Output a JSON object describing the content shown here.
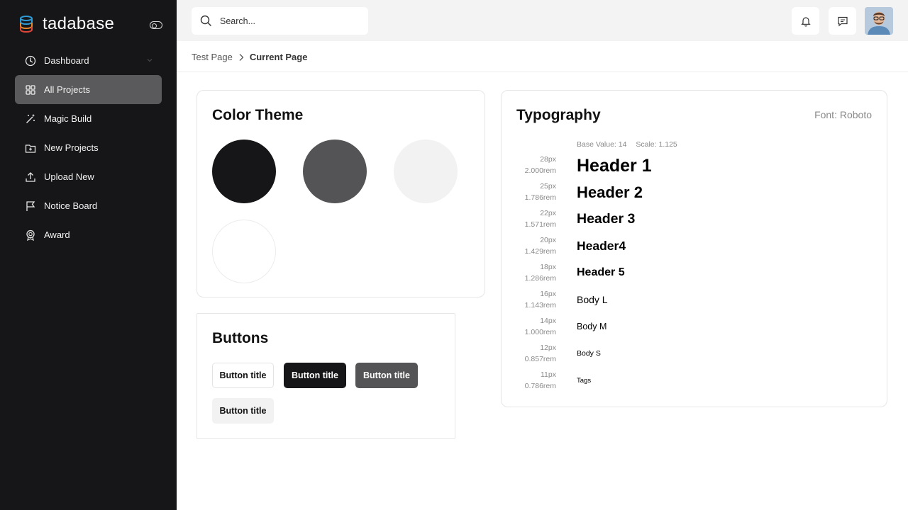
{
  "brand": {
    "name": "tadabase"
  },
  "sidebar": {
    "items": [
      {
        "label": "Dashboard",
        "icon": "dashboard-icon",
        "active": false,
        "has_chevron": true
      },
      {
        "label": "All Projects",
        "icon": "grid-icon",
        "active": true
      },
      {
        "label": "Magic Build",
        "icon": "magic-wand-icon",
        "active": false
      },
      {
        "label": "New Projects",
        "icon": "folder-plus-icon",
        "active": false
      },
      {
        "label": "Upload New",
        "icon": "upload-icon",
        "active": false
      },
      {
        "label": "Notice Board",
        "icon": "flag-icon",
        "active": false
      },
      {
        "label": "Award",
        "icon": "award-icon",
        "active": false
      }
    ]
  },
  "header": {
    "search_placeholder": "Search...",
    "notification_icon": "bell-icon",
    "message_icon": "message-icon"
  },
  "breadcrumb": {
    "parent": "Test Page",
    "current": "Current Page"
  },
  "color_theme": {
    "title": "Color Theme",
    "swatches": [
      "#161618",
      "#545456",
      "#f2f2f2",
      "#ffffff"
    ]
  },
  "buttons": {
    "title": "Buttons",
    "items": [
      {
        "label": "Button title",
        "style": "outline"
      },
      {
        "label": "Button title",
        "style": "dark"
      },
      {
        "label": "Button title",
        "style": "gray"
      },
      {
        "label": "Button title",
        "style": "light"
      }
    ]
  },
  "typography": {
    "title": "Typography",
    "font": "Font: Roboto",
    "base_value": "Base Value: 14",
    "scale": "Scale: 1.125",
    "rows": [
      {
        "px": "28px",
        "rem": "2.000rem",
        "label": "Header 1"
      },
      {
        "px": "25px",
        "rem": "1.786rem",
        "label": "Header 2"
      },
      {
        "px": "22px",
        "rem": "1.571rem",
        "label": "Header 3"
      },
      {
        "px": "20px",
        "rem": "1.429rem",
        "label": "Header4"
      },
      {
        "px": "18px",
        "rem": "1.286rem",
        "label": "Header 5"
      },
      {
        "px": "16px",
        "rem": "1.143rem",
        "label": "Body L"
      },
      {
        "px": "14px",
        "rem": "1.000rem",
        "label": "Body M"
      },
      {
        "px": "12px",
        "rem": "0.857rem",
        "label": "Body S"
      },
      {
        "px": "11px",
        "rem": "0.786rem",
        "label": "Tags"
      }
    ]
  }
}
